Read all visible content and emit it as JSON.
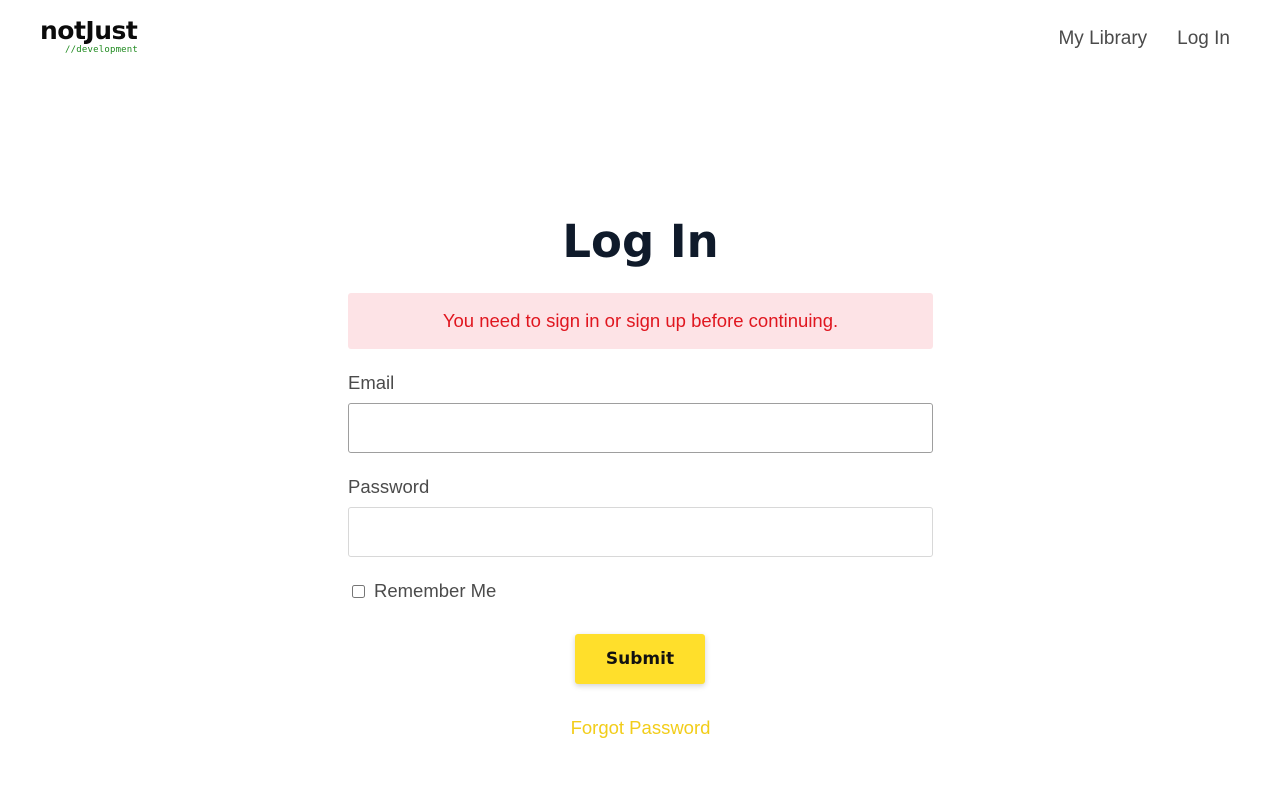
{
  "header": {
    "logo": {
      "name": "notJust",
      "tagline": "//development"
    },
    "nav": [
      {
        "label": "My Library"
      },
      {
        "label": "Log In"
      }
    ]
  },
  "main": {
    "title": "Log In",
    "alert": "You need to sign in or sign up before continuing.",
    "email": {
      "label": "Email",
      "value": "",
      "placeholder": ""
    },
    "password": {
      "label": "Password",
      "value": "",
      "placeholder": ""
    },
    "remember": {
      "label": "Remember Me",
      "checked": false
    },
    "submit_label": "Submit",
    "forgot_label": "Forgot Password"
  },
  "colors": {
    "accent": "#ffdf2b",
    "alert_bg": "#fde3e6",
    "alert_text": "#e0161f",
    "link": "#f2cd1a",
    "title": "#0f1a2a"
  }
}
